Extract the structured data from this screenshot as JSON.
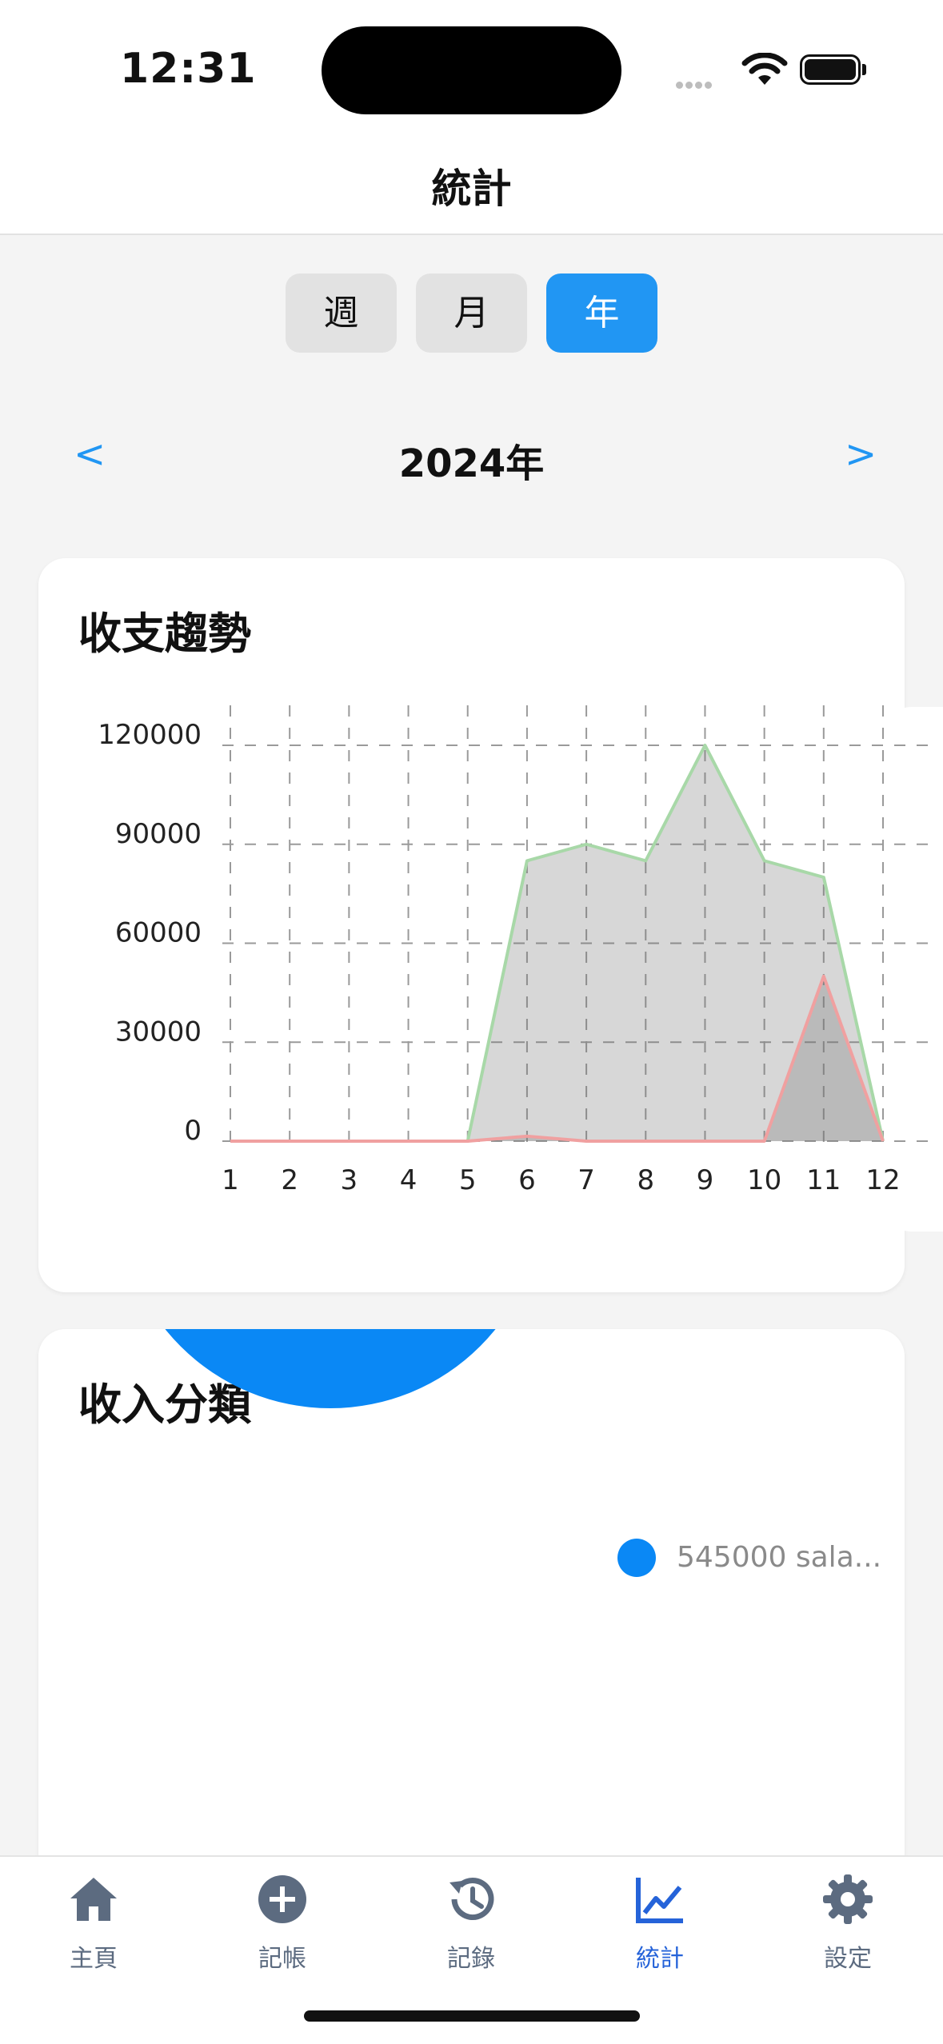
{
  "status_bar": {
    "time": "12:31"
  },
  "header": {
    "title": "統計"
  },
  "period_tabs": [
    {
      "label": "週",
      "active": false
    },
    {
      "label": "月",
      "active": false
    },
    {
      "label": "年",
      "active": true
    }
  ],
  "year_nav": {
    "prev": "<",
    "label": "2024年",
    "next": ">"
  },
  "trend_card": {
    "title": "收支趨勢"
  },
  "chart_data": {
    "type": "area",
    "x": [
      1,
      2,
      3,
      4,
      5,
      6,
      7,
      8,
      9,
      10,
      11,
      12
    ],
    "x_tick_labels": [
      "1",
      "2",
      "3",
      "4",
      "5",
      "6",
      "7",
      "8",
      "9",
      "10",
      "11",
      "12"
    ],
    "y_tick_labels": [
      "0",
      "30000",
      "60000",
      "90000",
      "120000"
    ],
    "ylim": [
      0,
      120000
    ],
    "grid": true,
    "series": [
      {
        "color": "#a8d8a8",
        "values": [
          0,
          0,
          0,
          0,
          0,
          85000,
          90000,
          85000,
          120000,
          85000,
          80000,
          0
        ]
      },
      {
        "color": "#f0a0a0",
        "values": [
          0,
          0,
          0,
          0,
          0,
          1500,
          0,
          0,
          0,
          0,
          50000,
          0
        ]
      }
    ]
  },
  "income_card": {
    "title": "收入分類",
    "legend": [
      {
        "label": "545000 sala...",
        "color": "#0a88f5"
      }
    ]
  },
  "tab_bar": [
    {
      "label": "主頁",
      "icon": "home-icon",
      "active": false
    },
    {
      "label": "記帳",
      "icon": "add-circle-icon",
      "active": false
    },
    {
      "label": "記錄",
      "icon": "history-icon",
      "active": false
    },
    {
      "label": "統計",
      "icon": "chart-line-icon",
      "active": true
    },
    {
      "label": "設定",
      "icon": "gear-icon",
      "active": false
    }
  ]
}
